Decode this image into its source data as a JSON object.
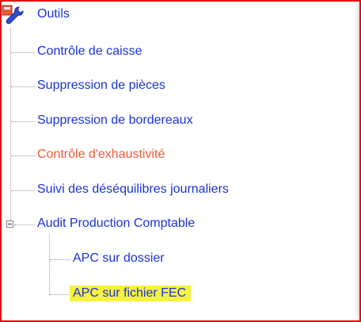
{
  "tree": {
    "root_label": "Outils",
    "root_icon": "tools-icon",
    "items": [
      {
        "label": "Contrôle de caisse",
        "state": "normal"
      },
      {
        "label": "Suppression de pièces",
        "state": "normal"
      },
      {
        "label": "Suppression de bordereaux",
        "state": "normal"
      },
      {
        "label": "Contrôle d'exhaustivité",
        "state": "warning"
      },
      {
        "label": "Suivi des déséquilibres journaliers",
        "state": "normal"
      },
      {
        "label": "Audit Production Comptable",
        "state": "expanded"
      }
    ],
    "children": [
      {
        "label": "APC sur dossier",
        "state": "normal"
      },
      {
        "label": "APC sur fichier FEC",
        "state": "highlighted"
      }
    ]
  },
  "colors": {
    "link": "#1a33d6",
    "warning": "#f05a38",
    "highlight": "#f6f240",
    "frame_border": "#e01010"
  }
}
